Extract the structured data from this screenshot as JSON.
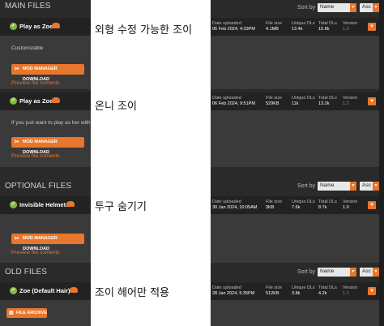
{
  "main_files": {
    "title": "MAIN FILES",
    "sort_label": "Sort by",
    "sort_field": "Name",
    "sort_order": "Asc",
    "files": [
      {
        "name": "Play as Zoe",
        "date_label": "Date uploaded",
        "date": "06 Feb 2024, 4:33PM",
        "size_label": "File size",
        "size": "4.1MB",
        "unique_label": "Unique DLs",
        "unique": "13.4k",
        "total_label": "Total DLs",
        "total": "15.8k",
        "version_label": "Version",
        "version": "1.3",
        "description": "Customizable",
        "mm_button": "MOD MANAGER DOWNLOAD",
        "preview": "Preview file contents"
      },
      {
        "name": "Play as Zoe",
        "date_label": "Date uploaded",
        "date": "06 Feb 2024, 9:51PM",
        "size_label": "File size",
        "size": "529KB",
        "unique_label": "Unique DLs",
        "unique": "11k",
        "total_label": "Total DLs",
        "total": "13.2k",
        "version_label": "Version",
        "version": "1.2",
        "description": "If you just want to play as her with",
        "mm_button": "MOD MANAGER DOWNLOAD",
        "preview": "Preview file contents"
      }
    ]
  },
  "optional_files": {
    "title": "OPTIONAL FILES",
    "sort_label": "Sort by",
    "sort_field": "Name",
    "sort_order": "Asc",
    "files": [
      {
        "name": "Invisible Helmets",
        "date_label": "Date uploaded",
        "date": "30 Jan 2024, 10:05AM",
        "size_label": "File size",
        "size": "3KB",
        "unique_label": "Unique DLs",
        "unique": "7.6k",
        "total_label": "Total DLs",
        "total": "8.7k",
        "version_label": "Version",
        "version": "1.0",
        "mm_button": "MOD MANAGER DOWNLOAD",
        "preview": "Preview file contents"
      }
    ]
  },
  "old_files": {
    "title": "OLD FILES",
    "sort_label": "Sort by",
    "sort_field": "Name",
    "sort_order": "Asc",
    "files": [
      {
        "name": "Zoe (Default Hair)",
        "date_label": "Date uploaded",
        "date": "28 Jan 2024, 5:35PM",
        "size_label": "File size",
        "size": "512KB",
        "unique_label": "Unique DLs",
        "unique": "3.8k",
        "total_label": "Total DLs",
        "total": "4.2k",
        "version_label": "Version",
        "version": "1.1"
      }
    ],
    "archive_button": "FILE ARCHIVE"
  },
  "captions": [
    "외형 수정 가능한 조이",
    "온니 조이",
    "투구 숨기기",
    "조이 헤어만 적용"
  ],
  "colors": {
    "accent": "#e8762c",
    "check": "#7cbf3c",
    "header": "#222222",
    "card": "#3a3a3a"
  }
}
